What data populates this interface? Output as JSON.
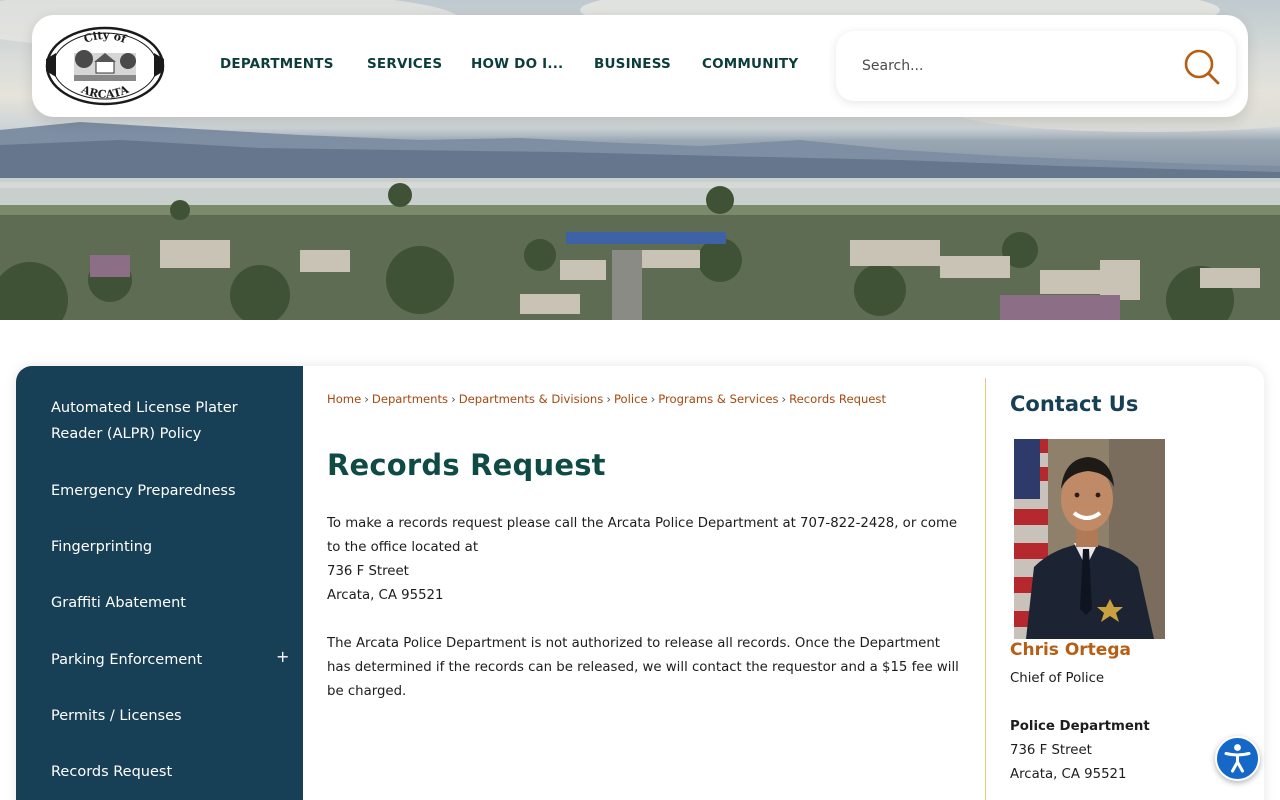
{
  "logo": {
    "top_text": "City of",
    "bottom_text": "ARCATA"
  },
  "nav": {
    "items": [
      {
        "label": "DEPARTMENTS"
      },
      {
        "label": "SERVICES"
      },
      {
        "label": "HOW DO I..."
      },
      {
        "label": "BUSINESS"
      },
      {
        "label": "COMMUNITY"
      }
    ]
  },
  "search": {
    "placeholder": "Search..."
  },
  "sidebar": {
    "items": [
      {
        "label": "Automated License Plater Reader (ALPR) Policy"
      },
      {
        "label": "Emergency Preparedness"
      },
      {
        "label": "Fingerprinting"
      },
      {
        "label": "Graffiti Abatement"
      },
      {
        "label": "Parking Enforcement",
        "expand": "+"
      },
      {
        "label": "Permits / Licenses"
      },
      {
        "label": "Records Request"
      }
    ]
  },
  "breadcrumb": {
    "items": [
      "Home",
      "Departments",
      "Departments & Divisions",
      "Police",
      "Programs & Services",
      "Records Request"
    ],
    "separator": "›"
  },
  "main": {
    "title": "Records Request",
    "paragraph1_lines": [
      "To make a records request please call the Arcata Police Department at 707-822-2428, or come",
      "to the office located at",
      "736 F Street",
      "Arcata, CA 95521"
    ],
    "paragraph2_lines": [
      "The Arcata Police Department is not authorized to release all records.  Once the Department",
      "has determined if the records can be released, we will contact the requestor and a $15 fee will",
      "be charged."
    ]
  },
  "contact": {
    "title": "Contact Us",
    "name": "Chris Ortega",
    "role": "Chief of Police",
    "department": "Police Department",
    "street": "736 F Street",
    "city": "Arcata, CA 95521"
  },
  "colors": {
    "sidebar_bg": "#173f55",
    "title_green": "#0f4a45",
    "link_orange": "#a7480f",
    "name_orange": "#b85d14",
    "divider_gold": "#e7c77a",
    "a11y_blue": "#1668c8"
  },
  "icons": {
    "search": "search-icon",
    "accessibility": "accessibility-icon",
    "expand": "plus-icon"
  }
}
